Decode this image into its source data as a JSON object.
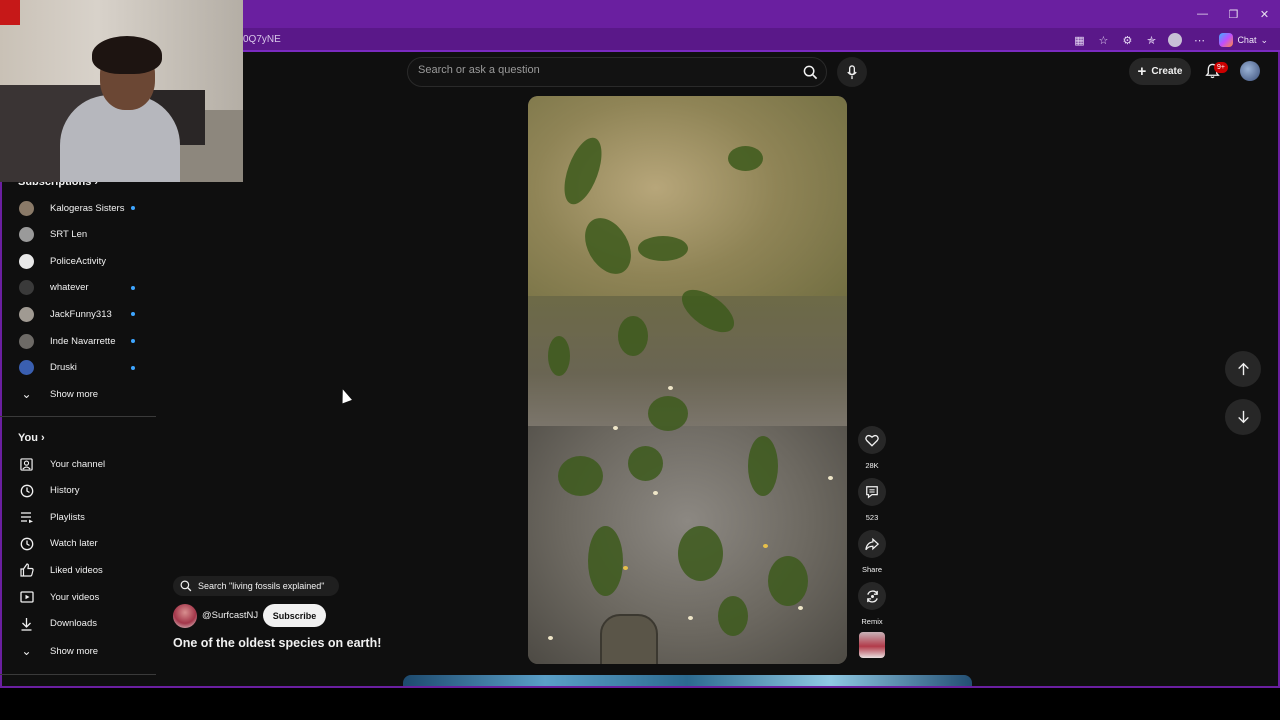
{
  "browser": {
    "url_fragment": "0Q7yNE",
    "copilot_label": "Chat",
    "window_controls": [
      "minimize-icon",
      "restore-icon",
      "close-icon"
    ],
    "toolbar_icons": [
      "apps-icon",
      "favorite-icon",
      "extension-icon",
      "collections-icon",
      "profile-icon",
      "more-icon"
    ]
  },
  "header": {
    "search_placeholder": "Search or ask a question",
    "create_label": "Create",
    "notification_badge": "9+"
  },
  "sidebar": {
    "subscriptions_title": "Subscriptions",
    "subscriptions": [
      {
        "name": "Kalogeras Sisters",
        "live": true,
        "color": "#8a7a68"
      },
      {
        "name": "SRT Len",
        "live": false,
        "color": "#9a9a9a"
      },
      {
        "name": "PoliceActivity",
        "live": false,
        "color": "#e8e8e8"
      },
      {
        "name": "whatever",
        "live": true,
        "color": "#3a3a3a"
      },
      {
        "name": "JackFunny313",
        "live": true,
        "color": "#a09a92"
      },
      {
        "name": "Inde Navarrette",
        "live": true,
        "color": "#6d6a66"
      },
      {
        "name": "Druski",
        "live": true,
        "color": "#3a5fb0"
      }
    ],
    "show_more_1": "Show more",
    "you_title": "You",
    "you_items": [
      {
        "label": "Your channel",
        "icon": "channel-icon"
      },
      {
        "label": "History",
        "icon": "history-icon"
      },
      {
        "label": "Playlists",
        "icon": "playlists-icon"
      },
      {
        "label": "Watch later",
        "icon": "watch-later-icon"
      },
      {
        "label": "Liked videos",
        "icon": "like-icon"
      },
      {
        "label": "Your videos",
        "icon": "your-videos-icon"
      },
      {
        "label": "Downloads",
        "icon": "download-icon"
      }
    ],
    "show_more_2": "Show more"
  },
  "short": {
    "search_suggestion": "Search \"living fossils explained\"",
    "channel": "@SurfcastNJ",
    "subscribe_label": "Subscribe",
    "title": "One of the oldest species on earth!",
    "likes": "28K",
    "comments": "523",
    "share_label": "Share",
    "remix_label": "Remix"
  }
}
